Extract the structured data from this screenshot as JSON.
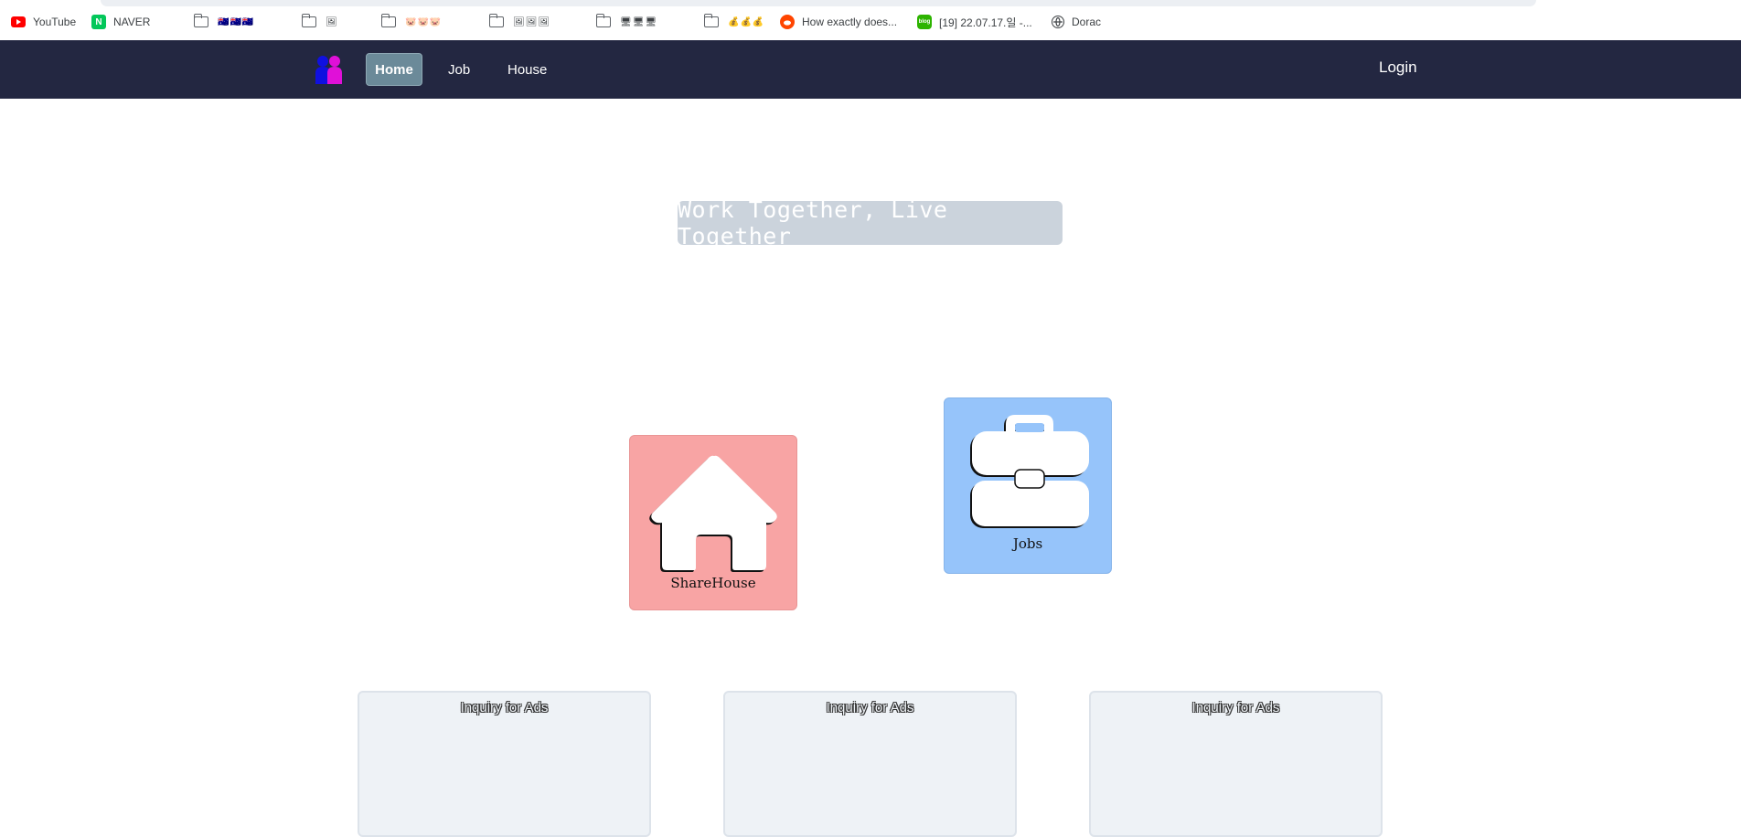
{
  "bookmarks": [
    {
      "label": "YouTube",
      "icon": "youtube-icon",
      "color": "#ff0000"
    },
    {
      "label": "NAVER",
      "icon": "naver-icon",
      "color": "#03c75a"
    },
    {
      "label": "🇦🇺🇦🇺🇦🇺",
      "icon": "folder-icon"
    },
    {
      "label": "🖼",
      "icon": "folder-icon"
    },
    {
      "label": "🐷🐷🐷",
      "icon": "folder-icon"
    },
    {
      "label": "🖼🖼🖼",
      "icon": "folder-icon"
    },
    {
      "label": "🖥🖥🖥",
      "icon": "folder-icon"
    },
    {
      "label": "💰💰💰",
      "icon": "folder-icon"
    },
    {
      "label": "How exactly does...",
      "icon": "reddit-icon",
      "color": "#ff4500"
    },
    {
      "label": "[19] 22.07.17.일 -...",
      "icon": "blog-icon",
      "color": "#2db400"
    },
    {
      "label": "Dorac",
      "icon": "globe-icon"
    }
  ],
  "nav": {
    "home": "Home",
    "job": "Job",
    "house": "House",
    "login": "Login"
  },
  "hero": {
    "text": "Work Together, Live Together"
  },
  "cards": {
    "house_label": "ShareHouse",
    "jobs_label": "Jobs"
  },
  "ads": [
    {
      "label": "Inquiry for Ads"
    },
    {
      "label": "Inquiry for Ads"
    },
    {
      "label": "Inquiry for Ads"
    }
  ],
  "colors": {
    "navbar": "#232741",
    "home_active": "#6b8a99",
    "house_card": "#f8a4a4",
    "jobs_card": "#96c4fa",
    "ad_box": "#eef2f6"
  }
}
